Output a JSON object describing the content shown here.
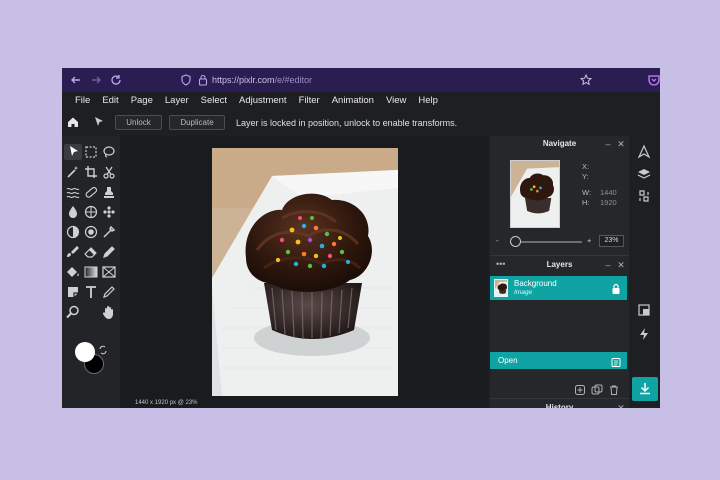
{
  "browser": {
    "url_host": "https://pixlr.com",
    "url_path": "/e/#editor"
  },
  "menu": [
    "File",
    "Edit",
    "Page",
    "Layer",
    "Select",
    "Adjustment",
    "Filter",
    "Animation",
    "View",
    "Help"
  ],
  "options": {
    "unlock_label": "Unlock",
    "duplicate_label": "Duplicate",
    "message": "Layer is locked in position, unlock to enable transforms."
  },
  "canvas": {
    "status": "1440 x 1920 px @ 23%"
  },
  "navigate": {
    "title": "Navigate",
    "x_label": "X:",
    "y_label": "Y:",
    "w_label": "W:",
    "w_value": "1440",
    "h_label": "H:",
    "h_value": "1920",
    "zoom": "23%",
    "zoom_minus": "-",
    "zoom_plus": "+"
  },
  "layers": {
    "title": "Layers",
    "items": [
      {
        "name": "Background",
        "type": "Image",
        "locked": true
      }
    ]
  },
  "history": {
    "title": "History",
    "items": [
      {
        "label": "Open"
      }
    ]
  },
  "colors": {
    "accent": "#0fa3a3",
    "browser_bar": "#2a1d52",
    "page_background": "#c8bfe7",
    "app_background": "#1e1f22"
  }
}
